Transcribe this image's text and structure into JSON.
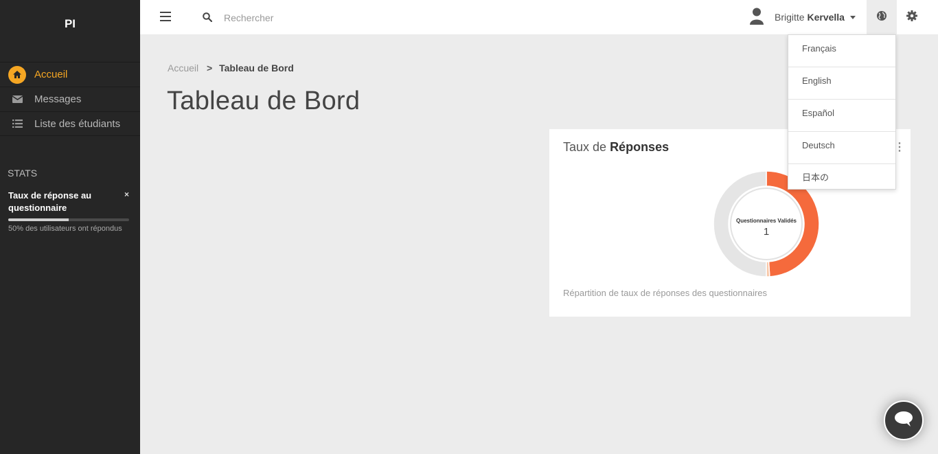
{
  "sidebar": {
    "brand": "PI",
    "nav": [
      {
        "label": "Accueil",
        "icon": "home-icon",
        "active": true
      },
      {
        "label": "Messages",
        "icon": "envelope-icon",
        "active": false
      },
      {
        "label": "Liste des étudiants",
        "icon": "list-icon",
        "active": false
      }
    ],
    "stats_title": "STATS",
    "stat": {
      "name": "Taux de réponse au questionnaire",
      "close": "×",
      "progress": 0.5,
      "description": "50% des utilisateurs ont répondus"
    }
  },
  "topbar": {
    "search_placeholder": "Rechercher",
    "user_first": "Brigitte",
    "user_last": "Kervella"
  },
  "breadcrumb": {
    "home": "Accueil",
    "separator": ">",
    "current": "Tableau de Bord"
  },
  "page_title": "Tableau de Bord",
  "panel": {
    "title_light": "Taux de",
    "title_bold": "Réponses",
    "dots": "⋮",
    "caption": "Répartition de taux de réponses des questionnaires"
  },
  "chart_data": {
    "type": "pie",
    "center_label": "Questionnaires Validés",
    "center_value": "1",
    "slices": [
      {
        "value": 49,
        "color": "#f56a3c"
      },
      {
        "value": 1,
        "color": "#f8c8a8"
      },
      {
        "value": 50,
        "color": "#e5e5e5"
      }
    ]
  },
  "language_menu": {
    "items": [
      "Français",
      "English",
      "Español",
      "Deutsch",
      "日本の"
    ]
  },
  "colors": {
    "accent": "#f5a623",
    "sidebar": "#262626",
    "chart_orange": "#f56a3c"
  }
}
